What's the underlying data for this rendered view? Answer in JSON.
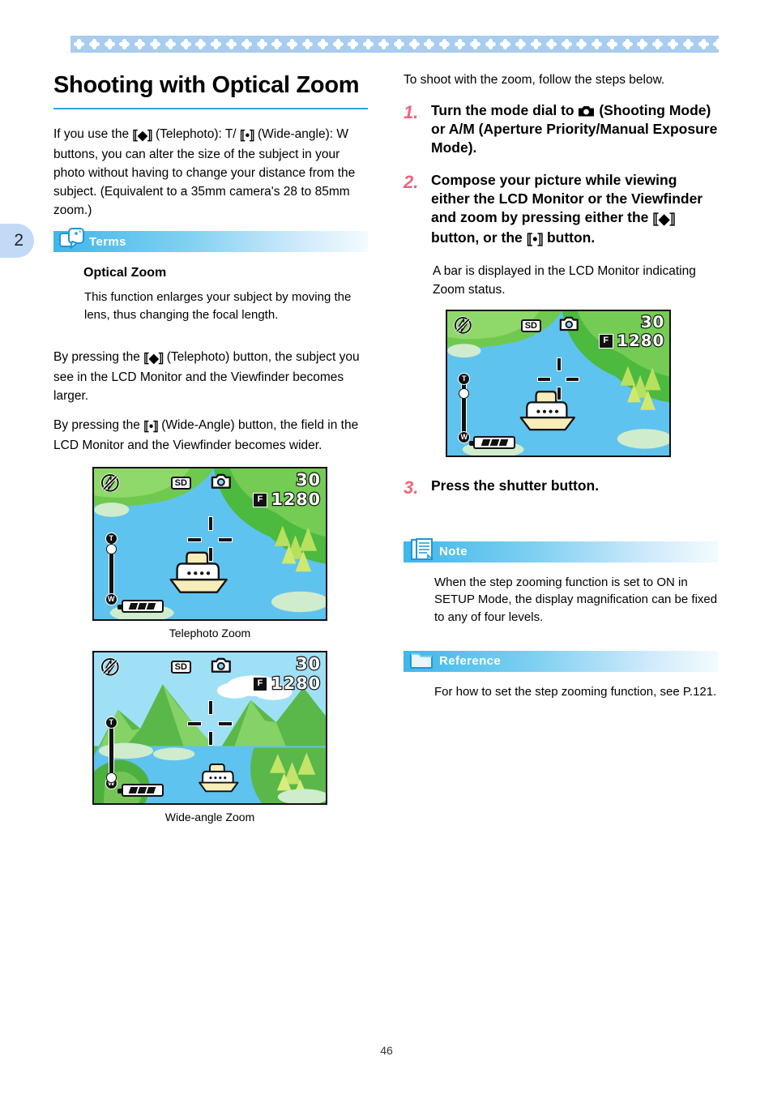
{
  "page": {
    "number": "46",
    "chapter_tab": "2"
  },
  "left": {
    "title": "Shooting with Optical Zoom",
    "intro": "If you use the [T] (Telephoto): T/ [W] (Wide-angle): W buttons, you can alter the size of the subject in your photo without having to change your distance from the subject. (Equivalent to a 35mm camera's 28 to 85mm zoom.)",
    "terms": {
      "label": "Terms",
      "subtitle": "Optical Zoom",
      "text": "This function enlarges your subject by moving the lens, thus changing the focal length."
    },
    "para_tele": "By pressing the [T] (Telephoto) button, the subject you see in the LCD Monitor and the Viewfinder becomes larger.",
    "para_wide": "By pressing the [W] (Wide-Angle) button, the field in the LCD Monitor and the Viewfinder becomes wider.",
    "caption_tele": "Telephoto Zoom",
    "caption_wide": "Wide-angle Zoom"
  },
  "right": {
    "lead": "To shoot with the zoom, follow the steps below.",
    "steps": [
      {
        "num": "1.",
        "text": "Turn the mode dial to [camera] (Shooting Mode) or A/M (Aperture Priority/Manual Exposure Mode)."
      },
      {
        "num": "2.",
        "text": "Compose your picture while viewing either the LCD Monitor or the Viewfinder and zoom by pressing either the [T] button, or the [W] button."
      },
      {
        "num": "3.",
        "text": "Press the shutter button."
      }
    ],
    "step2_note": "A bar is displayed in the LCD Monitor indicating Zoom status.",
    "note": {
      "label": "Note",
      "text": "When the step zooming function is set to ON in SETUP Mode, the display magnification can be fixed to any of four levels."
    },
    "reference": {
      "label": "Reference",
      "text": "For how to set the step zooming function, see P.121."
    }
  },
  "lcd": {
    "shots_remaining": "30",
    "resolution": "1280",
    "quality_badge": "F",
    "card_badge": "SD",
    "zoom_tele_label": "T",
    "zoom_wide_label": "W"
  },
  "colors": {
    "accent_blue": "#29a8e0",
    "band_blue": "#a8cdee",
    "step_number_pink": "#f4637f",
    "tab_blue": "#c3daf6",
    "lcd_water": "#5fc3ef",
    "lcd_land": "#5cc14a"
  }
}
